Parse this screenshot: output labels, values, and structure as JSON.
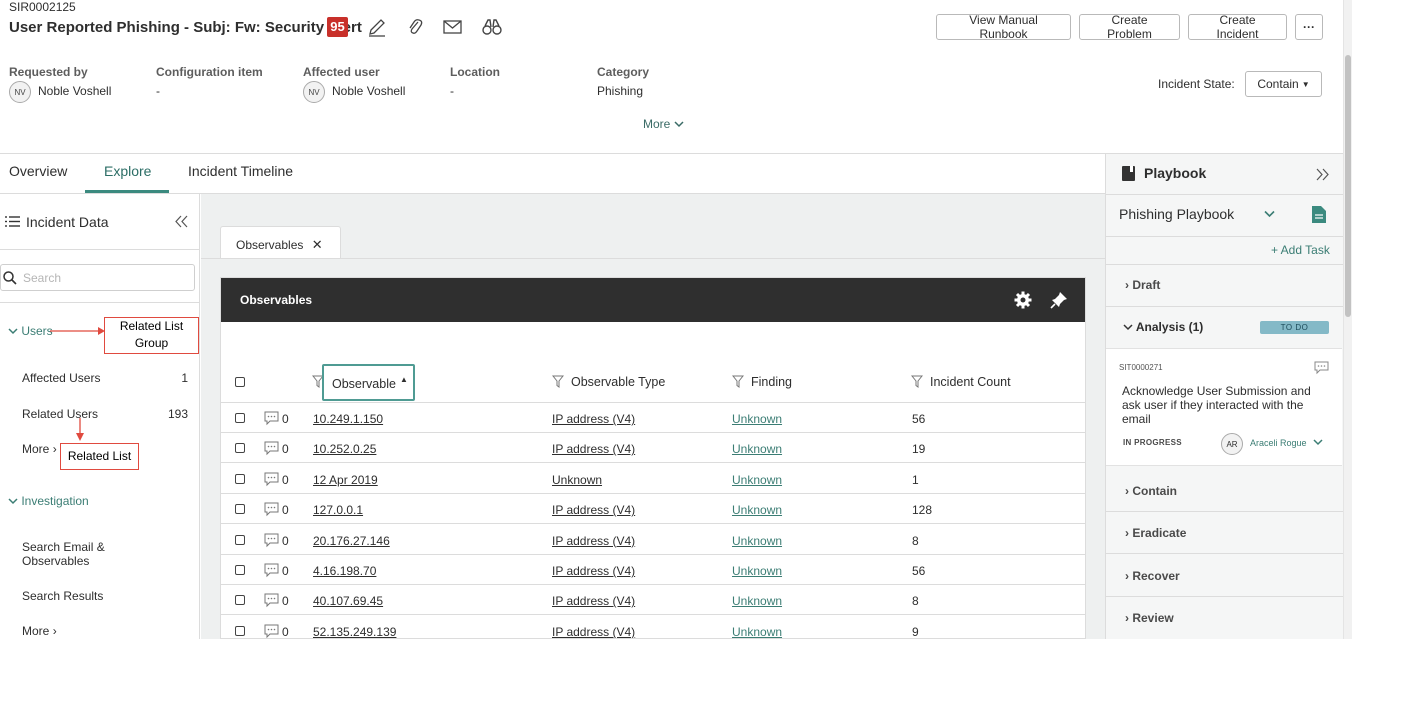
{
  "record": {
    "number": "SIR0002125",
    "title": "User Reported Phishing - Subj: Fw: Security Alert",
    "risk_score": "95"
  },
  "header_icons": [
    "pencil-icon",
    "paperclip-icon",
    "envelope-icon",
    "binoculars-icon"
  ],
  "buttons": {
    "runbook": "View Manual Runbook",
    "problem": "Create Problem",
    "incident": "Create Incident",
    "more": "···"
  },
  "fields": {
    "requested_by": {
      "label": "Requested by",
      "initials": "NV",
      "value": "Noble Voshell"
    },
    "config_item": {
      "label": "Configuration item",
      "value": "-"
    },
    "affected_user": {
      "label": "Affected user",
      "initials": "NV",
      "value": "Noble Voshell"
    },
    "location": {
      "label": "Location",
      "value": "-"
    },
    "category": {
      "label": "Category",
      "value": "Phishing"
    }
  },
  "more_label": "More",
  "incident_state": {
    "label": "Incident State:",
    "value": "Contain"
  },
  "tabs": [
    "Overview",
    "Explore",
    "Incident Timeline"
  ],
  "incident_data": {
    "title": "Incident Data",
    "search_placeholder": "Search",
    "groups": [
      {
        "label": "Users",
        "items": [
          {
            "label": "Affected Users",
            "count": "1"
          },
          {
            "label": "Related Users",
            "count": "193"
          },
          {
            "label": "More",
            "count": ""
          }
        ]
      },
      {
        "label": "Investigation",
        "items": [
          {
            "label": "Search Email & Observables",
            "count": ""
          },
          {
            "label": "Search Results",
            "count": ""
          },
          {
            "label": "More",
            "count": ""
          }
        ]
      }
    ]
  },
  "annotations": {
    "group": "Related List Group",
    "list": "Related List"
  },
  "observables": {
    "tab_label": "Observables",
    "panel_title": "Observables",
    "columns": [
      "Observable",
      "Observable Type",
      "Finding",
      "Incident Count"
    ],
    "rows": [
      {
        "comments": "0",
        "observable": "10.249.1.150",
        "type": "IP address (V4)",
        "finding": "Unknown",
        "count": "56"
      },
      {
        "comments": "0",
        "observable": "10.252.0.25",
        "type": "IP address (V4)",
        "finding": "Unknown",
        "count": "19"
      },
      {
        "comments": "0",
        "observable": "12 Apr 2019",
        "type": "Unknown",
        "finding": "Unknown",
        "count": "1"
      },
      {
        "comments": "0",
        "observable": "127.0.0.1",
        "type": "IP address (V4)",
        "finding": "Unknown",
        "count": "128"
      },
      {
        "comments": "0",
        "observable": "20.176.27.146",
        "type": "IP address (V4)",
        "finding": "Unknown",
        "count": "8"
      },
      {
        "comments": "0",
        "observable": "4.16.198.70",
        "type": "IP address (V4)",
        "finding": "Unknown",
        "count": "56"
      },
      {
        "comments": "0",
        "observable": "40.107.69.45",
        "type": "IP address (V4)",
        "finding": "Unknown",
        "count": "8"
      },
      {
        "comments": "0",
        "observable": "52.135.249.139",
        "type": "IP address (V4)",
        "finding": "Unknown",
        "count": "9"
      }
    ]
  },
  "playbook": {
    "title": "Playbook",
    "selected": "Phishing Playbook",
    "add_task": "+ Add Task",
    "sections": [
      "Draft",
      "Analysis (1)",
      "Contain",
      "Eradicate",
      "Recover",
      "Review"
    ],
    "analysis_badge": "TO DO",
    "task": {
      "number": "SIT0000271",
      "description": "Acknowledge User Submission and ask user if they interacted with the email",
      "status": "IN PROGRESS",
      "assignee_initials": "AR",
      "assignee": "Araceli Rogue"
    }
  },
  "colors": {
    "accent": "#3b8a7f",
    "risk": "#c8302a",
    "annotation": "#e04a3f",
    "panel_header": "#2f2f2f"
  }
}
